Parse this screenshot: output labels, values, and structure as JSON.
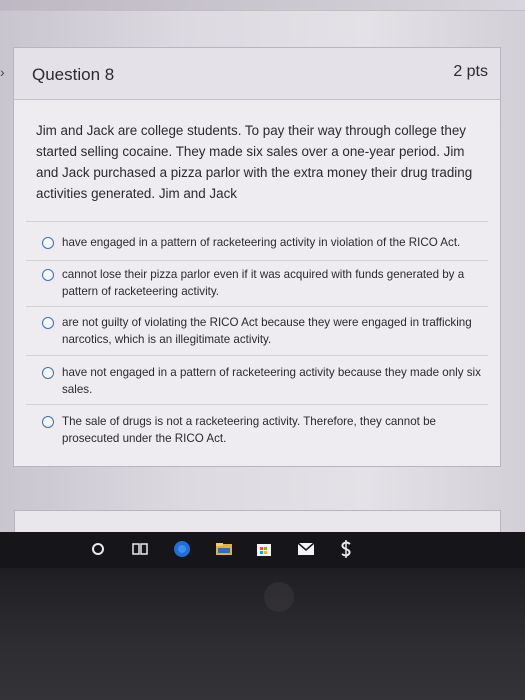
{
  "question": {
    "title": "Question 8",
    "points": "2 pts",
    "stem": "Jim and Jack are college students. To pay their way through college they started selling cocaine. They made six sales over a one-year period. Jim and Jack purchased a pizza parlor with the extra money their drug trading activities generated. Jim and Jack",
    "options": [
      {
        "label": "have engaged in a pattern of racketeering activity in violation of the RICO Act."
      },
      {
        "label": "cannot lose their pizza parlor even if it was acquired with funds generated by a pattern of racketeering activity."
      },
      {
        "label": "are not guilty of violating the RICO Act because they were engaged in trafficking narcotics, which is an illegitimate activity."
      },
      {
        "label": "have not engaged in a pattern of racketeering activity because they made only six sales."
      },
      {
        "label": "The sale of drugs is not a racketeering activity. Therefore, they cannot be prosecuted under the RICO Act."
      }
    ]
  },
  "taskbar": {
    "icons": [
      "cortana-icon",
      "task-view-icon",
      "edge-icon",
      "file-explorer-icon",
      "store-icon",
      "mail-icon",
      "dollar-icon"
    ]
  },
  "colors": {
    "radio_border": "#3b70b8",
    "taskbar": "#16151a",
    "card_background": "#eeecf1"
  }
}
